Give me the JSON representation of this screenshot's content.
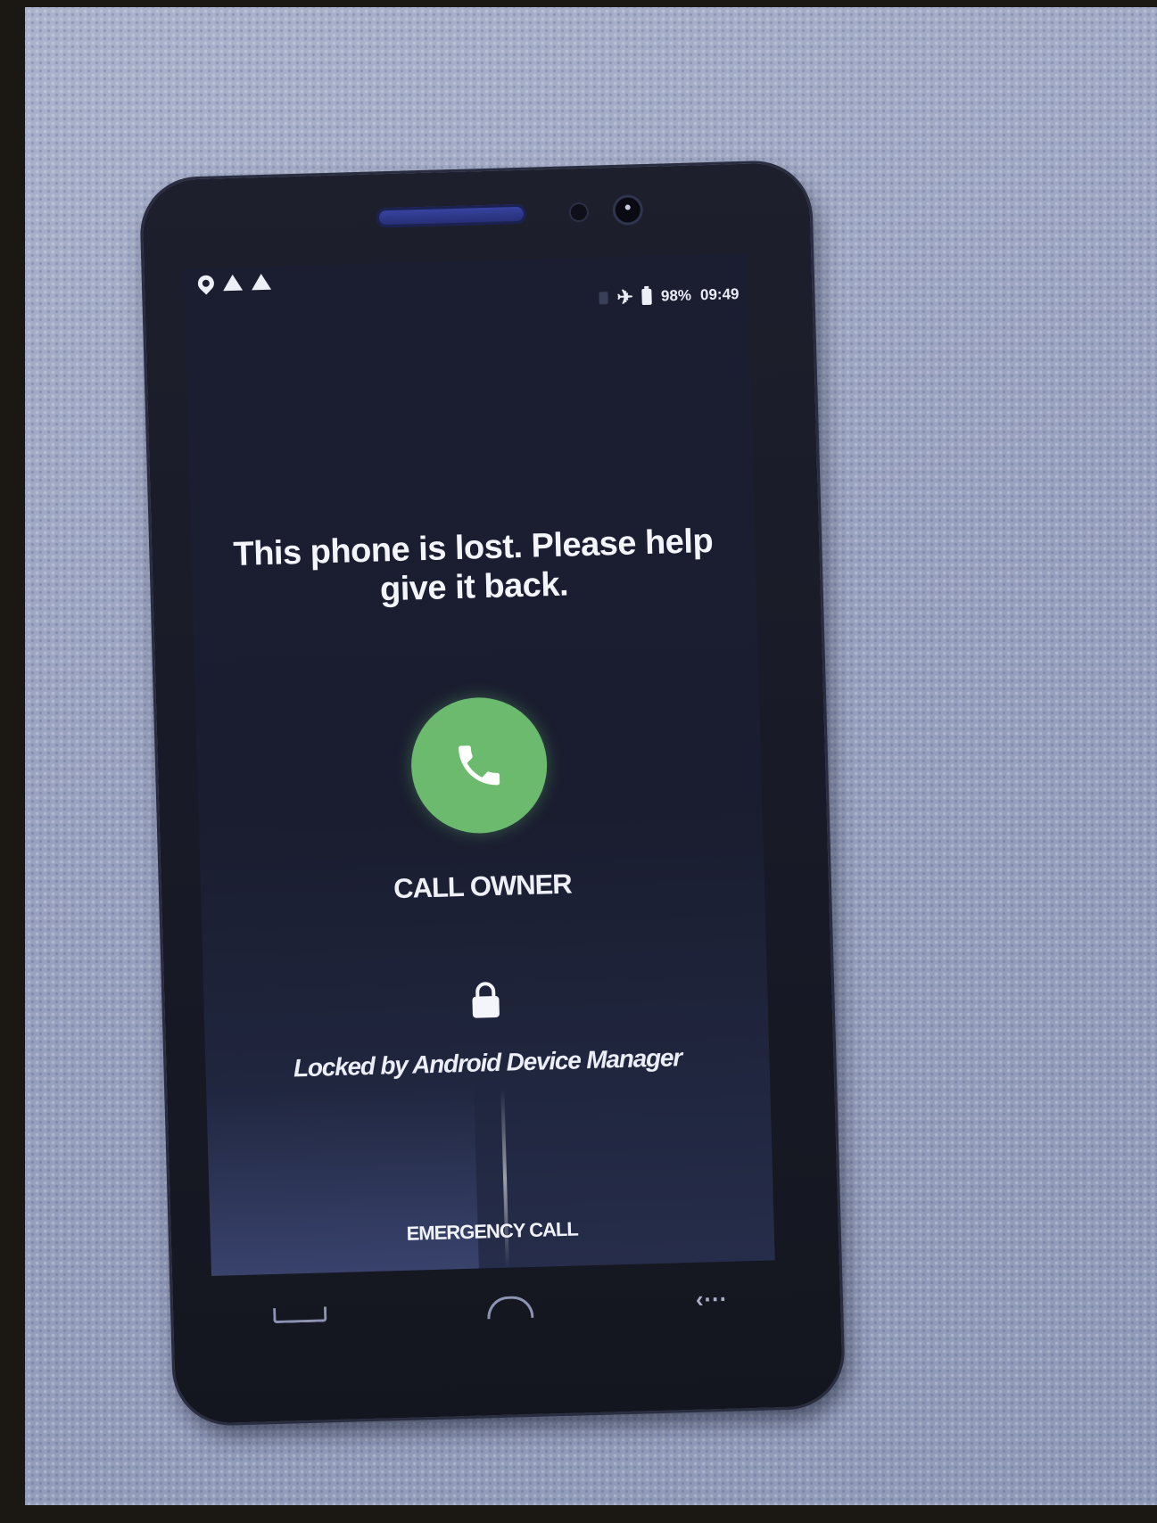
{
  "status_bar": {
    "battery_percent": "98%",
    "time": "09:49",
    "icons": [
      "location-pin-icon",
      "warning-icon",
      "warning-icon",
      "signal-icon",
      "airplane-mode-icon",
      "battery-icon"
    ]
  },
  "lock_screen": {
    "message": "This phone is lost. Please help give it back.",
    "call_button_icon": "phone-handset-icon",
    "call_label": "CALL OWNER",
    "lock_icon": "padlock-icon",
    "locked_text": "Locked by Android Device Manager",
    "emergency_label": "EMERGENCY CALL"
  },
  "nav_keys": [
    "menu-key-icon",
    "home-key-icon",
    "back-key-icon"
  ],
  "colors": {
    "call_button": "#6bba6e",
    "screen_background": "#1b1e30",
    "text": "#f4f5fa"
  }
}
